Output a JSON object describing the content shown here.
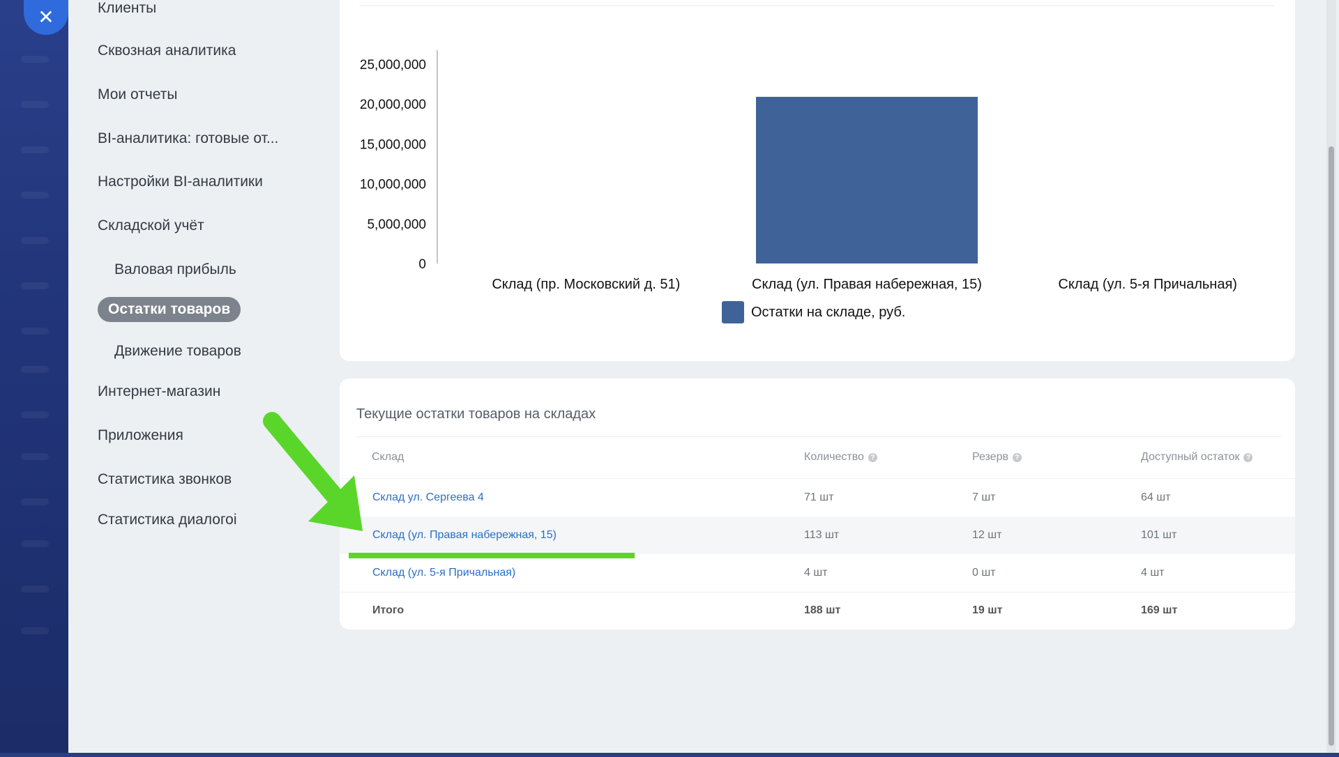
{
  "close_glyph": "✕",
  "sidebar": {
    "items": [
      {
        "label": "Клиенты"
      },
      {
        "label": "Сквозная аналитика"
      },
      {
        "label": "Мои отчеты"
      },
      {
        "label": "BI-аналитика: готовые от..."
      },
      {
        "label": "Настройки BI-аналитики"
      },
      {
        "label": "Складской учёт"
      },
      {
        "label": "Валовая прибыль"
      },
      {
        "label": "Остатки товаров"
      },
      {
        "label": "Движение товаров"
      },
      {
        "label": "Интернет-магазин"
      },
      {
        "label": "Приложения"
      },
      {
        "label": "Статистика звонков"
      },
      {
        "label": "Статистика диалогоі"
      }
    ]
  },
  "chart_data": {
    "type": "bar",
    "categories": [
      "Склад (пр. Московский д. 51)",
      "Склад (ул. Правая набережная, 15)",
      "Склад (ул. 5-я Причальная)"
    ],
    "series": [
      {
        "name": "Остатки на складе, руб.",
        "values": [
          0,
          20900000,
          0
        ]
      }
    ],
    "ylim": [
      0,
      25000000
    ],
    "y_ticks": [
      "0",
      "5,000,000",
      "10,000,000",
      "15,000,000",
      "20,000,000",
      "25,000,000"
    ],
    "bar_color": "#3f6299",
    "legend_position": "bottom-center"
  },
  "table": {
    "title": "Текущие остатки товаров на складах",
    "headers": {
      "warehouse": "Склад",
      "qty": "Количество",
      "reserve": "Резерв",
      "available": "Доступный остаток"
    },
    "rows": [
      {
        "warehouse": "Склад ул. Сергеева 4",
        "qty": "71 шт",
        "reserve": "7 шт",
        "available": "64 шт"
      },
      {
        "warehouse": "Склад (ул. Правая набережная, 15)",
        "qty": "113 шт",
        "reserve": "12 шт",
        "available": "101 шт"
      },
      {
        "warehouse": "Склад (ул. 5-я Причальная)",
        "qty": "4 шт",
        "reserve": "0 шт",
        "available": "4 шт"
      }
    ],
    "total": {
      "label": "Итого",
      "qty": "188 шт",
      "reserve": "19 шт",
      "available": "169 шт"
    }
  },
  "colors": {
    "accent": "#2f6bdc",
    "link": "#2b6fc6",
    "active_nav": "#7c838c",
    "annotation": "#5ad62a"
  }
}
